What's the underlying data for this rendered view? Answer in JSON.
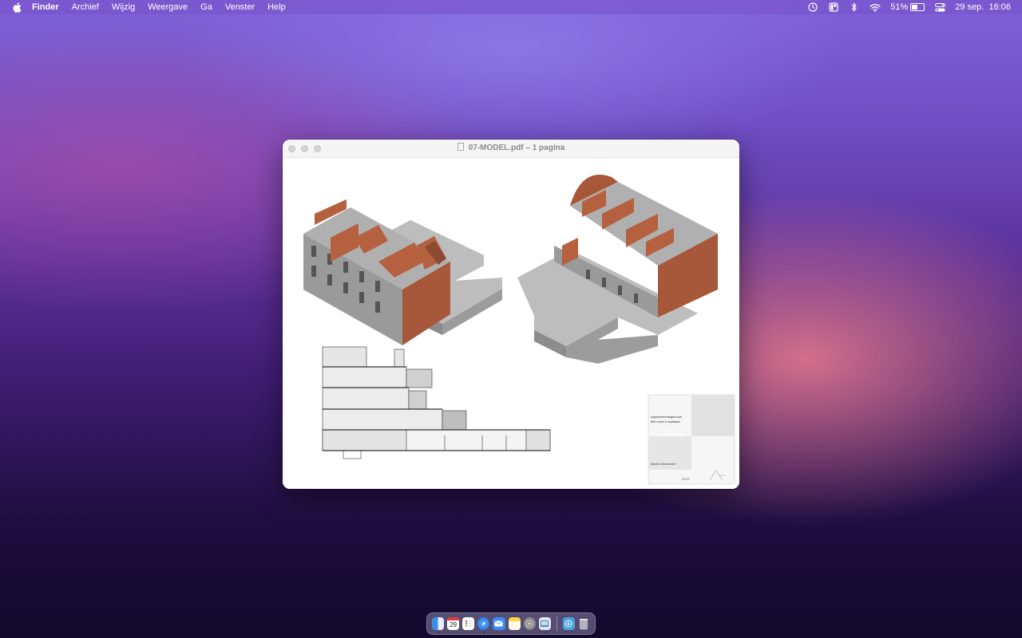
{
  "menubar": {
    "app": "Finder",
    "items": [
      "Archief",
      "Wijzig",
      "Weergave",
      "Ga",
      "Venster",
      "Help"
    ],
    "battery_percent": "51%",
    "battery_level": 0.51,
    "datetime": "29 sep.  16:06"
  },
  "window": {
    "title": "07-MODEL.pdf – 1 pagina"
  },
  "drawing": {
    "titleblock": {
      "project": "Appartementsgebouw",
      "line2": "BIM model & maatstaat",
      "scale_stamp": "22.01",
      "stamp_text": "Model & Doorsnede",
      "number": "07/07"
    }
  },
  "dock": {
    "calendar_day": "29",
    "apps": [
      "finder",
      "calendar",
      "reminders",
      "safari",
      "mail",
      "notes",
      "settings",
      "preview",
      "downloads",
      "trash"
    ]
  },
  "colors": {
    "brick": "#a85a3a",
    "concrete": "#a9a9a9",
    "accent": "#7a5bd6"
  }
}
